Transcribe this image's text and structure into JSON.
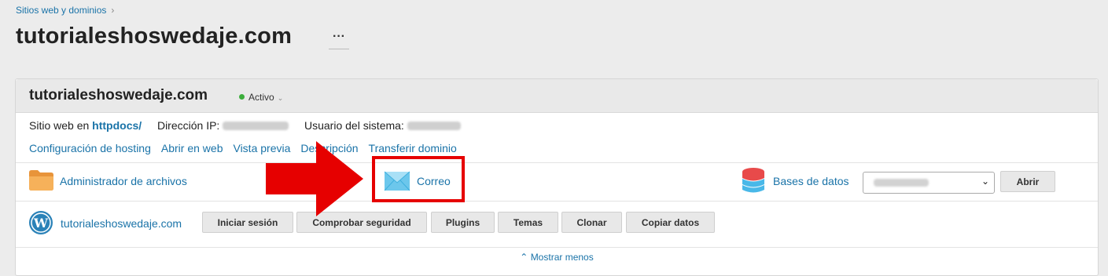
{
  "breadcrumb": {
    "label": "Sitios web y dominios",
    "chevron": "›"
  },
  "header": {
    "title": "tutorialeshoswedaje.com",
    "more_label": "···"
  },
  "panel": {
    "domain": "tutorialeshoswedaje.com",
    "status": {
      "label": "Activo",
      "color": "#3cae3c"
    },
    "info": {
      "site_prefix": "Sitio web en",
      "site_path": "httpdocs/",
      "ip_label": "Dirección IP:",
      "user_label": "Usuario del sistema:"
    },
    "links": [
      "Configuración de hosting",
      "Abrir en web",
      "Vista previa",
      "Descripción",
      "Transferir dominio"
    ],
    "tools": {
      "file_manager": "Administrador de archivos",
      "mail": "Correo",
      "databases": "Bases de datos",
      "open_button": "Abrir"
    },
    "wordpress": {
      "site": "tutorialeshoswedaje.com",
      "buttons": [
        "Iniciar sesión",
        "Comprobar seguridad",
        "Plugins",
        "Temas",
        "Clonar",
        "Copiar datos"
      ]
    },
    "show_less": "Mostrar menos"
  },
  "icons": {
    "folder": "folder-icon",
    "mail": "mail-envelope-icon",
    "database": "database-icon",
    "wordpress": "wordpress-icon",
    "arrow": "red-arrow-annotation",
    "highlight": "red-highlight-box"
  },
  "colors": {
    "accent": "#1a73a8",
    "annotation": "#e60000"
  }
}
